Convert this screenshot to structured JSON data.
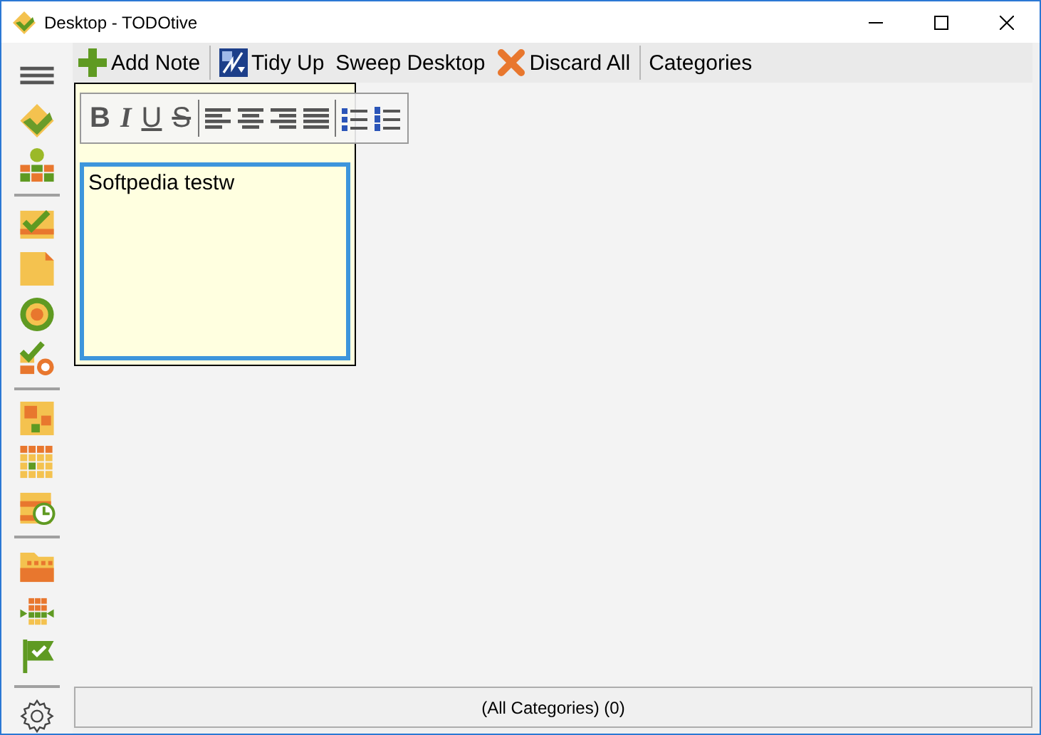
{
  "window": {
    "title": "Desktop - TODOtive"
  },
  "toolbar": [
    {
      "kind": "add",
      "label": "Add Note",
      "group_start": false
    },
    {
      "kind": "tidy",
      "label": "Tidy Up",
      "group_start": true
    },
    {
      "kind": "plain",
      "label": "Sweep Desktop",
      "group_start": false
    },
    {
      "kind": "discard",
      "label": "Discard All",
      "group_start": false
    },
    {
      "kind": "plain",
      "label": "Categories",
      "group_start": true
    }
  ],
  "note": {
    "format_buttons": [
      {
        "kind": "bold",
        "label": "B"
      },
      {
        "kind": "italic",
        "label": "I"
      },
      {
        "kind": "underline",
        "label": "U"
      },
      {
        "kind": "strike",
        "label": "S"
      },
      {
        "kind": "align-left"
      },
      {
        "kind": "align-center"
      },
      {
        "kind": "align-right"
      },
      {
        "kind": "justify"
      },
      {
        "kind": "bullets"
      },
      {
        "kind": "numbered"
      }
    ],
    "text": "Softpedia testw"
  },
  "status_bar": {
    "text": "(All Categories) (0)"
  }
}
